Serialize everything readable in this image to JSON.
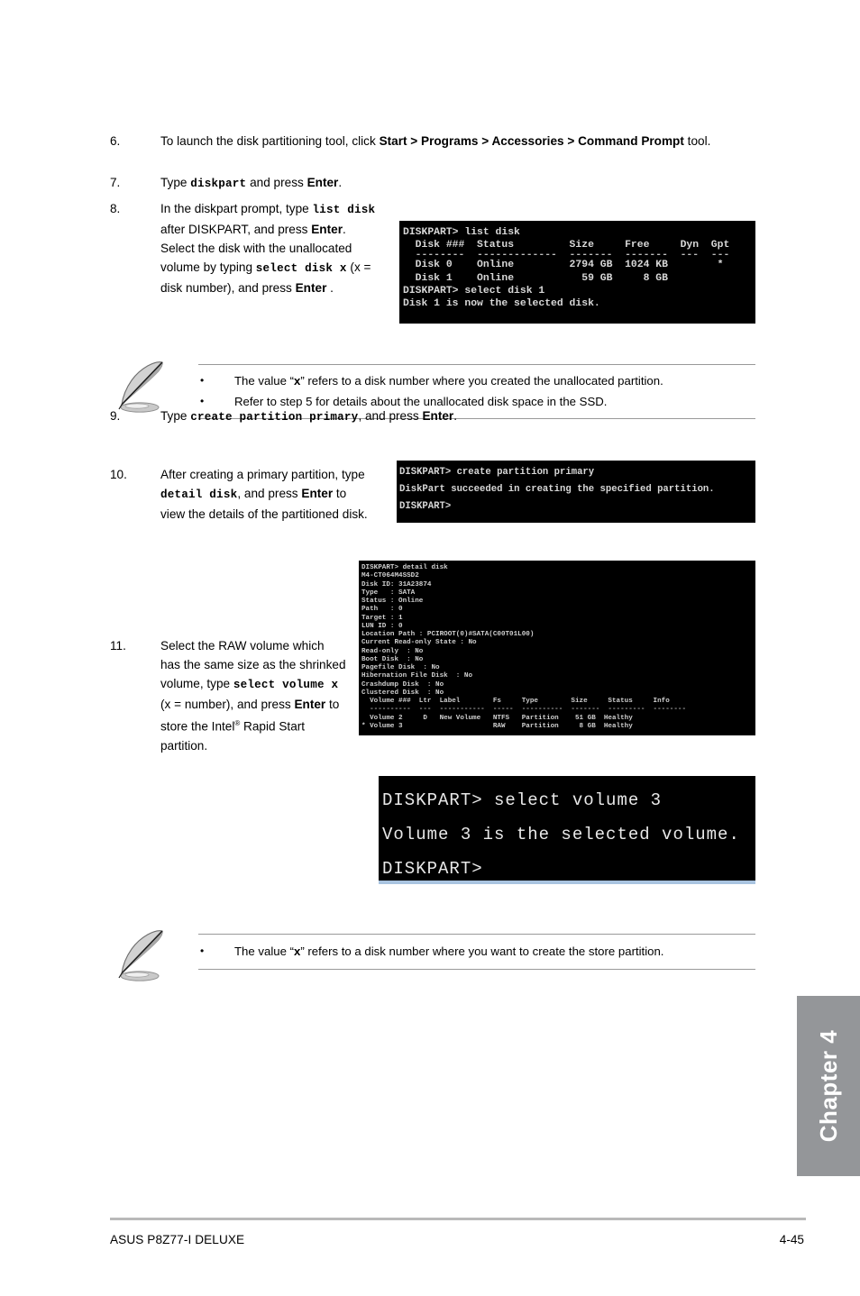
{
  "document": {
    "footer_left": "ASUS P8Z77-I DELUXE",
    "footer_right": "4-45",
    "chapter_tab": "Chapter 4"
  },
  "steps": {
    "s6": {
      "num": "6.",
      "t1": "To launch the disk partitioning tool, click ",
      "bold1": "Start > Programs > Accessories > Command Prompt",
      "t2": " tool."
    },
    "s7": {
      "num": "7.",
      "t1": "Type ",
      "code1": "diskpart",
      "t2": " and press ",
      "bold1": "Enter",
      "t3": "."
    },
    "s8": {
      "num": "8.",
      "t1": "In the diskpart prompt, type ",
      "code1": "list disk",
      "t2": " after DISKPART, and press ",
      "bold1": "Enter",
      "t3": ". Select the disk with the unallocated volume by typing ",
      "code2": "select disk x",
      "t4": " (x = disk number), and press ",
      "bold2": "Enter",
      "t5": " ."
    },
    "s9": {
      "num": "9.",
      "t1": "Type ",
      "code1": "create partition primary",
      "t2": ", and press ",
      "bold1": "Enter",
      "t3": "."
    },
    "s10": {
      "num": "10.",
      "t1": "After creating a primary partition, type ",
      "code1": "detail disk",
      "t2": ", and press ",
      "bold1": "Enter",
      "t3": " to view the details of the partitioned disk."
    },
    "s11": {
      "num": "11.",
      "t1": "Select the RAW volume which has the same size as the shrinked volume, type ",
      "code1": "select volume x",
      "t2": " (x = number), and press ",
      "bold1": "Enter",
      "t3": " to store the Intel",
      "sup": "®",
      "t4": " Rapid Start partition."
    }
  },
  "notes": {
    "note1": {
      "bullet": "•",
      "items": [
        {
          "pre": "The value “",
          "bold": "x",
          "post": "” refers to a disk number where you created the unallocated partition."
        },
        {
          "pre": "Refer to step 5 for details about the unallocated disk space in the SSD.",
          "bold": "",
          "post": ""
        }
      ]
    },
    "note2": {
      "bullet": "•",
      "items": [
        {
          "pre": "The value “",
          "bold": "x",
          "post": "” refers to a disk number where you want to create the store partition."
        }
      ]
    }
  },
  "terminals": {
    "list_disk": {
      "l1": "DISKPART> list disk",
      "l2": "",
      "l3": "  Disk ###  Status         Size     Free     Dyn  Gpt",
      "l4": "  --------  -------------  -------  -------  ---  ---",
      "l5": "  Disk 0    Online         2794 GB  1024 KB        *",
      "l6": "  Disk 1    Online           59 GB     8 GB",
      "l7": "",
      "l8": "DISKPART> select disk 1",
      "l9": "",
      "l10": "Disk 1 is now the selected disk."
    },
    "create_partition": {
      "l1": "DISKPART> create partition primary",
      "l2": "DiskPart succeeded in creating the specified partition.",
      "l3": "DISKPART>"
    },
    "detail_disk": {
      "l1": "DISKPART> detail disk",
      "l2": "",
      "l3": "M4-CT064M4SSD2",
      "l4": "Disk ID: 31A23874",
      "l5": "Type   : SATA",
      "l6": "Status : Online",
      "l7": "Path   : 0",
      "l8": "Target : 1",
      "l9": "LUN ID : 0",
      "l10": "Location Path : PCIROOT(0)#SATA(C00T01L00)",
      "l11": "Current Read-only State : No",
      "l12": "Read-only  : No",
      "l13": "Boot Disk  : No",
      "l14": "Pagefile Disk  : No",
      "l15": "Hibernation File Disk  : No",
      "l16": "Crashdump Disk  : No",
      "l17": "Clustered Disk  : No",
      "l18": "",
      "l19": "  Volume ###  Ltr  Label        Fs     Type        Size     Status     Info",
      "l20": "  ----------  ---  -----------  -----  ----------  -------  ---------  --------",
      "l21": "  Volume 2     D   New Volume   NTFS   Partition    51 GB  Healthy",
      "l22": "* Volume 3                      RAW    Partition     8 GB  Healthy"
    },
    "select_volume": {
      "l1": "DISKPART> select volume 3",
      "l2": "Volume 3 is the selected volume.",
      "l3": "DISKPART>"
    }
  }
}
